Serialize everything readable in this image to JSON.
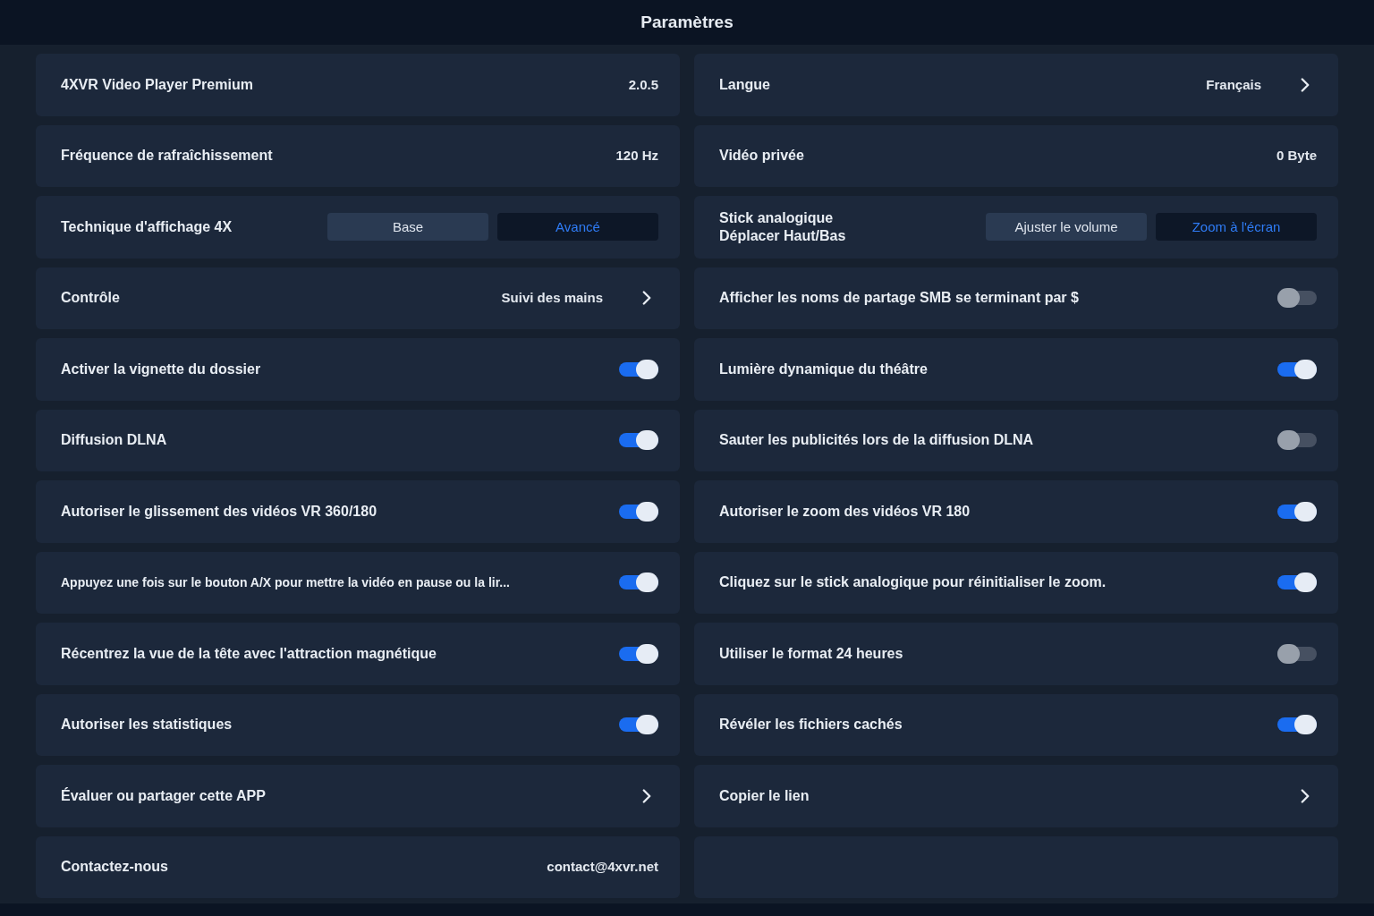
{
  "header": {
    "title": "Paramètres"
  },
  "columns": [
    {
      "rows": [
        {
          "kind": "info",
          "label": "4XVR Video Player Premium",
          "value": "2.0.5"
        },
        {
          "kind": "info",
          "label": "Fréquence de rafraîchissement",
          "value": "120 Hz"
        },
        {
          "kind": "segmented",
          "label": "Technique d'affichage 4X",
          "options": [
            {
              "label": "Base",
              "selected": false
            },
            {
              "label": "Avancé",
              "selected": true
            }
          ]
        },
        {
          "kind": "link",
          "label": "Contrôle",
          "value": "Suivi des mains"
        },
        {
          "kind": "toggle",
          "label": "Activer la vignette du dossier",
          "on": true
        },
        {
          "kind": "toggle",
          "label": "Diffusion DLNA",
          "on": true
        },
        {
          "kind": "toggle",
          "label": "Autoriser le glissement des vidéos VR 360/180",
          "on": true
        },
        {
          "kind": "toggle",
          "label": "Appuyez une fois sur le bouton A/X pour mettre la vidéo en pause ou la lir...",
          "on": true
        },
        {
          "kind": "toggle",
          "label": "Récentrez la vue de la tête avec l'attraction magnétique",
          "on": true
        },
        {
          "kind": "toggle",
          "label": "Autoriser les statistiques",
          "on": true
        },
        {
          "kind": "link",
          "label": "Évaluer ou partager cette APP"
        },
        {
          "kind": "info",
          "label": "Contactez-nous",
          "value": "contact@4xvr.net"
        }
      ]
    },
    {
      "rows": [
        {
          "kind": "link",
          "label": "Langue",
          "value": "Français"
        },
        {
          "kind": "info",
          "label": "Vidéo privée",
          "value": "0 Byte"
        },
        {
          "kind": "segmented",
          "label": "Stick analogique\nDéplacer Haut/Bas",
          "options": [
            {
              "label": "Ajuster le volume",
              "selected": false
            },
            {
              "label": "Zoom à l'écran",
              "selected": true
            }
          ]
        },
        {
          "kind": "toggle",
          "label": "Afficher les noms de partage SMB se terminant par $",
          "on": false
        },
        {
          "kind": "toggle",
          "label": "Lumière dynamique du théâtre",
          "on": true
        },
        {
          "kind": "toggle",
          "label": "Sauter les publicités lors de la diffusion DLNA",
          "on": false
        },
        {
          "kind": "toggle",
          "label": "Autoriser le zoom des vidéos VR 180",
          "on": true
        },
        {
          "kind": "toggle",
          "label": "Cliquez sur le stick analogique pour réinitialiser le zoom.",
          "on": true
        },
        {
          "kind": "toggle",
          "label": "Utiliser le format 24 heures",
          "on": false
        },
        {
          "kind": "toggle",
          "label": "Révéler les fichiers cachés",
          "on": true
        },
        {
          "kind": "link",
          "label": "Copier le lien"
        }
      ]
    }
  ]
}
